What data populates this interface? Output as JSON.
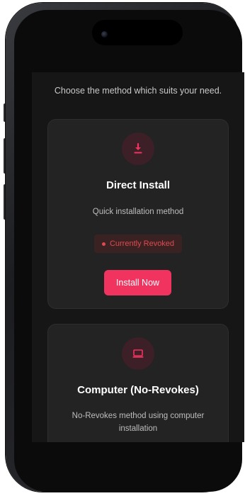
{
  "header": {
    "subtitle": "Choose the method which suits your need."
  },
  "methods": [
    {
      "icon": "download-icon",
      "title": "Direct Install",
      "description": "Quick installation method",
      "status": "Currently Revoked",
      "status_color": "#e0494f",
      "action_label": "Install Now"
    },
    {
      "icon": "laptop-icon",
      "title": "Computer (No-Revokes)",
      "description": "No-Revokes method using computer installation"
    }
  ],
  "colors": {
    "accent": "#f0335f",
    "card_background": "#232323",
    "screen_background": "#161616",
    "icon_background": "#3c1f27"
  }
}
